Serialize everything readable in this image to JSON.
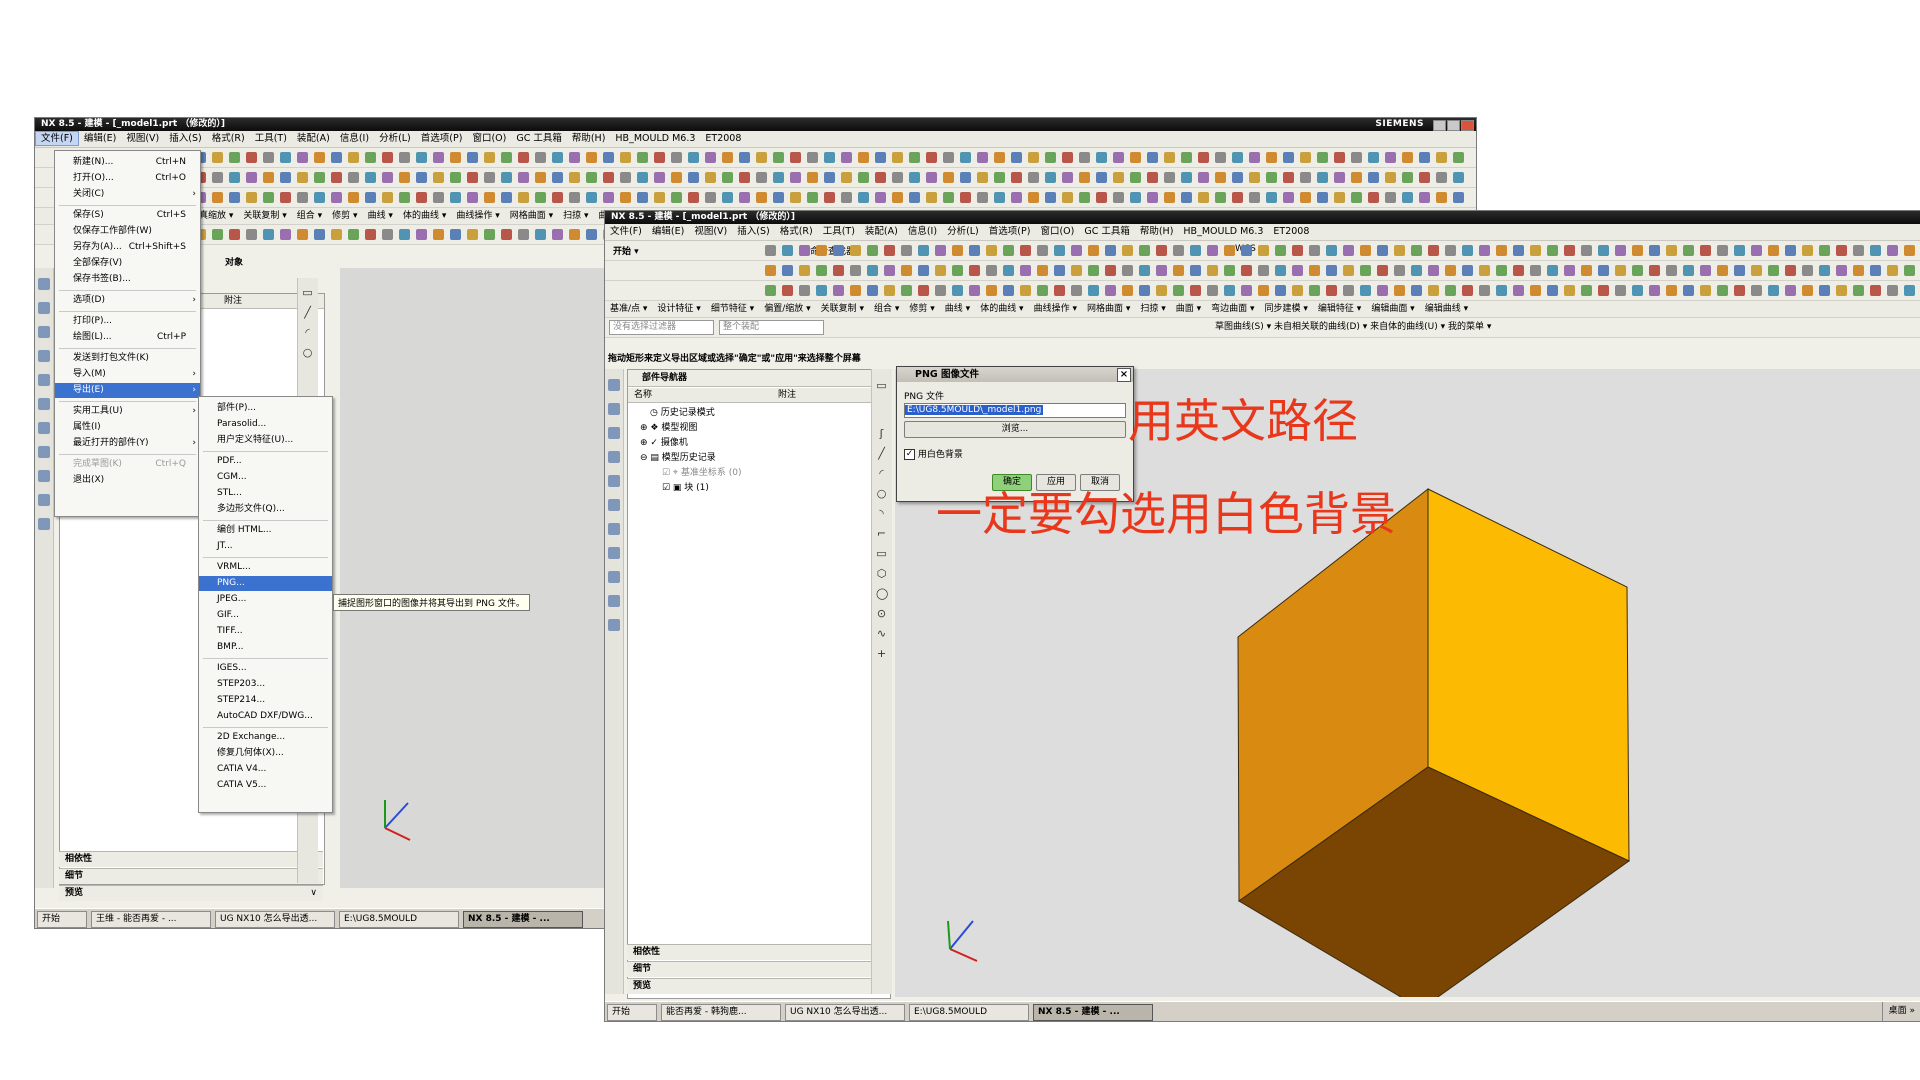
{
  "window1": {
    "title": "NX 8.5 - 建模 - [_model1.prt （修改的）]",
    "brand": "SIEMENS",
    "menu": [
      "文件(F)",
      "编辑(E)",
      "视图(V)",
      "插入(S)",
      "格式(R)",
      "工具(T)",
      "装配(A)",
      "信息(I)",
      "分析(L)",
      "首选项(P)",
      "窗口(O)",
      "GC 工具箱",
      "帮助(H)",
      "HB_MOULD M6.3",
      "ET2008"
    ],
    "cmds": [
      "仿真缩放 ▾",
      "关联复制 ▾",
      "组合 ▾",
      "修剪 ▾",
      "曲线 ▾",
      "体的曲线 ▾",
      "曲线操作 ▾",
      "网格曲面 ▾",
      "扫掠 ▾",
      "曲面 ▾"
    ],
    "nav_col_note": "附注",
    "nav_title_fragment": "对象",
    "sections": [
      "相依性",
      "细节",
      "预览"
    ],
    "taskbar": [
      "开始",
      "王维 - 能否再爱 - ...",
      "UG NX10 怎么导出透...",
      "E:\\UG8.5MOULD",
      "NX 8.5 - 建模 - ..."
    ]
  },
  "file_menu": {
    "items": [
      {
        "label": "新建(N)...",
        "shortcut": "Ctrl+N"
      },
      {
        "label": "打开(O)...",
        "shortcut": "Ctrl+O"
      },
      {
        "label": "关闭(C)",
        "shortcut": ""
      },
      {
        "label": "保存(S)",
        "shortcut": "Ctrl+S"
      },
      {
        "label": "仅保存工作部件(W)",
        "shortcut": ""
      },
      {
        "label": "另存为(A)...",
        "shortcut": "Ctrl+Shift+S"
      },
      {
        "label": "全部保存(V)",
        "shortcut": ""
      },
      {
        "label": "保存书签(B)...",
        "shortcut": ""
      },
      {
        "label": "选项(D)",
        "shortcut": ""
      },
      {
        "label": "打印(P)...",
        "shortcut": ""
      },
      {
        "label": "绘图(L)...",
        "shortcut": "Ctrl+P"
      },
      {
        "label": "发送到打包文件(K)",
        "shortcut": ""
      },
      {
        "label": "导入(M)",
        "shortcut": ""
      },
      {
        "label": "导出(E)",
        "shortcut": ""
      },
      {
        "label": "实用工具(U)",
        "shortcut": ""
      },
      {
        "label": "属性(I)",
        "shortcut": ""
      },
      {
        "label": "最近打开的部件(Y)",
        "shortcut": ""
      },
      {
        "label": "完成草图(K)",
        "shortcut": "Ctrl+Q"
      },
      {
        "label": "退出(X)",
        "shortcut": ""
      }
    ]
  },
  "export_menu": {
    "items": [
      "部件(P)...",
      "Parasolid...",
      "用户定义特征(U)...",
      "PDF...",
      "CGM...",
      "STL...",
      "多边形文件(Q)...",
      "编创 HTML...",
      "JT...",
      "VRML...",
      "PNG...",
      "JPEG...",
      "GIF...",
      "TIFF...",
      "BMP...",
      "IGES...",
      "STEP203...",
      "STEP214...",
      "AutoCAD DXF/DWG...",
      "2D Exchange...",
      "修复几何体(X)...",
      "CATIA V4...",
      "CATIA V5..."
    ]
  },
  "tooltip": "捕捉图形窗口的图像并将其导出到 PNG 文件。",
  "window2": {
    "title": "NX 8.5 - 建模 - [_model1.prt （修改的）]",
    "menu": [
      "文件(F)",
      "编辑(E)",
      "视图(V)",
      "插入(S)",
      "格式(R)",
      "工具(T)",
      "装配(A)",
      "信息(I)",
      "分析(L)",
      "首选项(P)",
      "窗口(O)",
      "GC 工具箱",
      "帮助(H)",
      "HB_MOULD M6.3",
      "ET2008"
    ],
    "start_label": "开始 ▾",
    "command_finder": "命令查找器",
    "wcs": "WCS ▾",
    "cmds": [
      "基准/点 ▾",
      "设计特征 ▾",
      "细节特征 ▾",
      "偏置/缩放 ▾",
      "关联复制 ▾",
      "组合 ▾",
      "修剪 ▾",
      "曲线 ▾",
      "体的曲线 ▾",
      "曲线操作 ▾",
      "网格曲面 ▾",
      "扫掠 ▾",
      "曲面 ▾",
      "弯边曲面 ▾",
      "同步建模 ▾",
      "编辑特征 ▾",
      "编辑曲面 ▾",
      "编辑曲线 ▾"
    ],
    "filter_text": "没有选择过滤器",
    "assembly_text": "整个装配",
    "sel_tail": "草图曲线(S) ▾  未自相关联的曲线(D) ▾  来自体的曲线(U) ▾  我的菜单 ▾",
    "status": "拖动矩形来定义导出区域或选择\"确定\"或\"应用\"来选择整个屏幕",
    "navigator": {
      "title": "部件导航器",
      "col_name": "名称",
      "col_note": "附注",
      "nodes": [
        "历史记录模式",
        "模型视图",
        "摄像机",
        "模型历史记录",
        "基准坐标系 (0)",
        "块 (1)"
      ]
    },
    "sections": [
      "相依性",
      "细节",
      "预览"
    ],
    "taskbar": [
      "开始",
      "能否再爱 - 韩狗鹿...",
      "UG NX10 怎么导出透...",
      "E:\\UG8.5MOULD",
      "NX 8.5 - 建模 - ..."
    ],
    "tray": "桌面 »"
  },
  "png_dialog": {
    "title": "PNG 图像文件",
    "field_label": "PNG 文件",
    "path_value": "E:\\UG8.5MOULD\\_model1.png",
    "browse_label": "浏览...",
    "checkbox_label": "用白色背景",
    "checkbox_checked": true,
    "ok_label": "确定",
    "apply_label": "应用",
    "cancel_label": "取消"
  },
  "annotations": {
    "english_path": "用英文路径",
    "white_bg": "一定要勾选用白色背景"
  },
  "colors": {
    "cube_top": "#d98a10",
    "cube_right": "#fcbb02",
    "cube_front": "#7a4502",
    "annotation": "#e8371a",
    "highlight": "#3b72d0"
  }
}
